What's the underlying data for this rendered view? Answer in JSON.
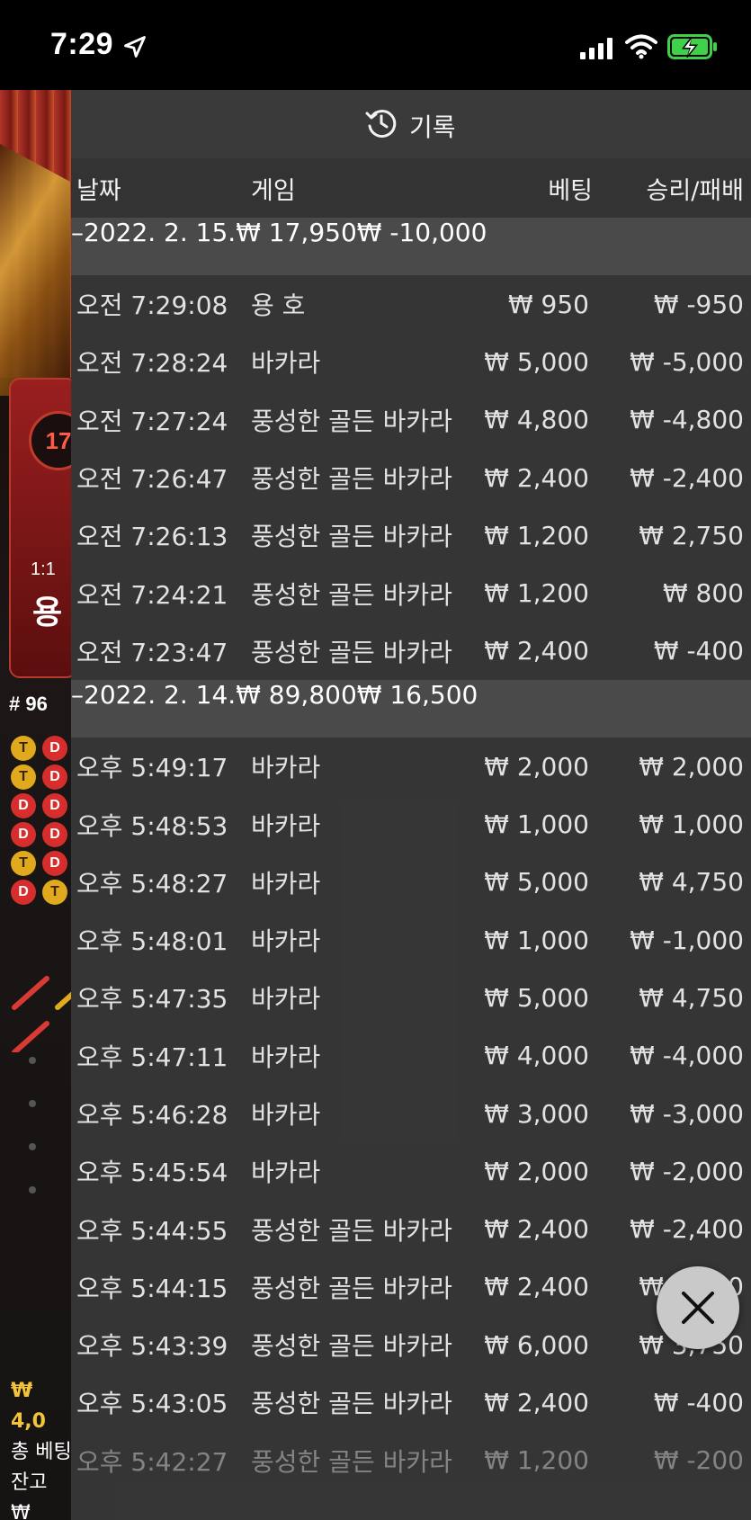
{
  "status_bar": {
    "time": "7:29"
  },
  "game": {
    "round_badge": "17",
    "odds": "1:1",
    "bet_name": "용",
    "round_number": "# 96",
    "beads": [
      "T",
      "D",
      "T",
      "D",
      "D",
      "D",
      "D",
      "D",
      "T",
      "D",
      "D",
      "T"
    ],
    "bottom_lines": [
      "₩ 4,0",
      "총 베팅",
      "잔고 ₩"
    ]
  },
  "history": {
    "title": "기록",
    "columns": {
      "date": "날짜",
      "game": "게임",
      "bet": "베팅",
      "win_loss": "승리/패배"
    },
    "groups": [
      {
        "date": "–2022. 2. 15.",
        "bet_total": "₩ 17,950",
        "wl_total": "₩ -10,000",
        "rows": [
          {
            "time": "오전 7:29:08",
            "game": "용 호",
            "bet": "₩ 950",
            "wl": "₩ -950"
          },
          {
            "time": "오전 7:28:24",
            "game": "바카라",
            "bet": "₩ 5,000",
            "wl": "₩ -5,000"
          },
          {
            "time": "오전 7:27:24",
            "game": "풍성한 골든 바카라",
            "bet": "₩ 4,800",
            "wl": "₩ -4,800"
          },
          {
            "time": "오전 7:26:47",
            "game": "풍성한 골든 바카라",
            "bet": "₩ 2,400",
            "wl": "₩ -2,400"
          },
          {
            "time": "오전 7:26:13",
            "game": "풍성한 골든 바카라",
            "bet": "₩ 1,200",
            "wl": "₩ 2,750"
          },
          {
            "time": "오전 7:24:21",
            "game": "풍성한 골든 바카라",
            "bet": "₩ 1,200",
            "wl": "₩ 800"
          },
          {
            "time": "오전 7:23:47",
            "game": "풍성한 골든 바카라",
            "bet": "₩ 2,400",
            "wl": "₩ -400"
          }
        ]
      },
      {
        "date": "–2022. 2. 14.",
        "bet_total": "₩ 89,800",
        "wl_total": "₩ 16,500",
        "rows": [
          {
            "time": "오후 5:49:17",
            "game": "바카라",
            "bet": "₩ 2,000",
            "wl": "₩ 2,000"
          },
          {
            "time": "오후 5:48:53",
            "game": "바카라",
            "bet": "₩ 1,000",
            "wl": "₩ 1,000"
          },
          {
            "time": "오후 5:48:27",
            "game": "바카라",
            "bet": "₩ 5,000",
            "wl": "₩ 4,750"
          },
          {
            "time": "오후 5:48:01",
            "game": "바카라",
            "bet": "₩ 1,000",
            "wl": "₩ -1,000"
          },
          {
            "time": "오후 5:47:35",
            "game": "바카라",
            "bet": "₩ 5,000",
            "wl": "₩ 4,750"
          },
          {
            "time": "오후 5:47:11",
            "game": "바카라",
            "bet": "₩ 4,000",
            "wl": "₩ -4,000"
          },
          {
            "time": "오후 5:46:28",
            "game": "바카라",
            "bet": "₩ 3,000",
            "wl": "₩ -3,000"
          },
          {
            "time": "오후 5:45:54",
            "game": "바카라",
            "bet": "₩ 2,000",
            "wl": "₩ -2,000"
          },
          {
            "time": "오후 5:44:55",
            "game": "풍성한 골든 바카라",
            "bet": "₩ 2,400",
            "wl": "₩ -2,400"
          },
          {
            "time": "오후 5:44:15",
            "game": "풍성한 골든 바카라",
            "bet": "₩ 2,400",
            "wl": "₩ 1,200"
          },
          {
            "time": "오후 5:43:39",
            "game": "풍성한 골든 바카라",
            "bet": "₩ 6,000",
            "wl": "₩ 3,750"
          },
          {
            "time": "오후 5:43:05",
            "game": "풍성한 골든 바카라",
            "bet": "₩ 2,400",
            "wl": "₩ -400"
          },
          {
            "time": "오후 5:42:27",
            "game": "풍성한 골든 바카라",
            "bet": "₩ 1,200",
            "wl": "₩ -200"
          }
        ]
      }
    ]
  }
}
